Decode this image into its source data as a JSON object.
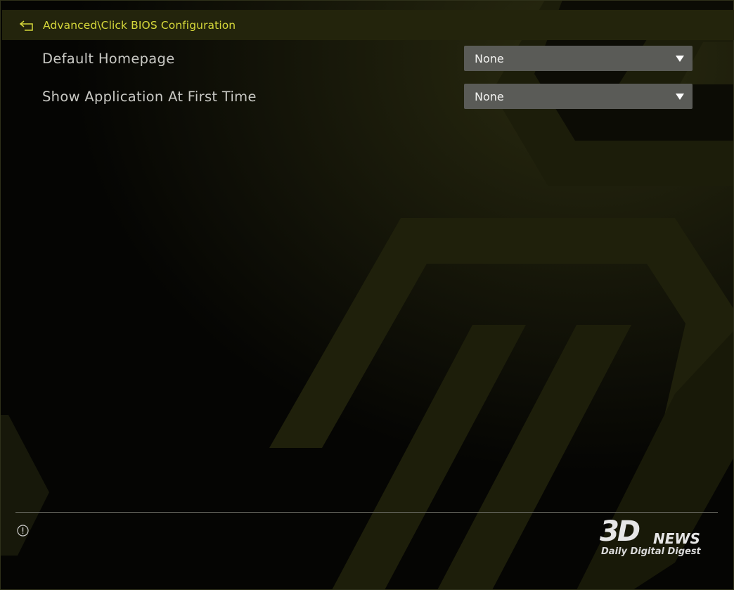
{
  "header": {
    "breadcrumb": "Advanced\\Click BIOS Configuration"
  },
  "settings": [
    {
      "label": "Default Homepage",
      "value": "None"
    },
    {
      "label": "Show Application At First Time",
      "value": "None"
    }
  ],
  "watermark": {
    "logo_main": "3D",
    "logo_news": "NEWS",
    "tagline": "Daily Digital Digest"
  },
  "colors": {
    "accent": "#d6d83a",
    "header_bg": "#23240c",
    "select_bg": "#5a5b57"
  }
}
